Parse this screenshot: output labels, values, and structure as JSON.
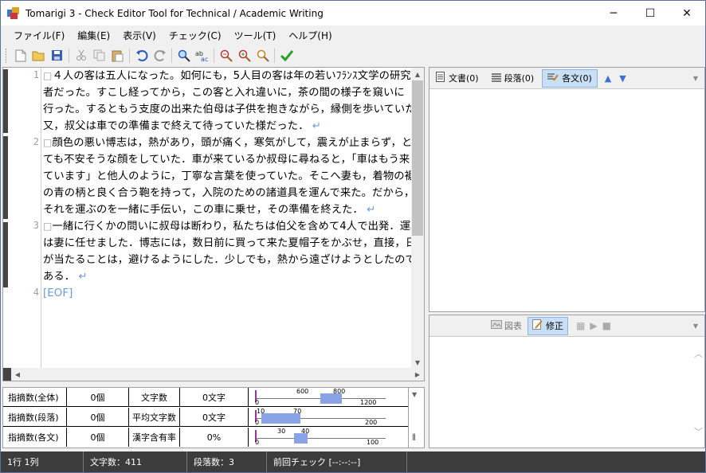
{
  "window": {
    "title": "Tomarigi 3 - Check Editor Tool for Technical / Academic Writing",
    "minimize": "─",
    "maximize": "☐",
    "close": "✕"
  },
  "menu": [
    "ファイル(F)",
    "編集(E)",
    "表示(V)",
    "チェック(C)",
    "ツール(T)",
    "ヘルプ(H)"
  ],
  "toolbar_icons": [
    "new-file-icon",
    "open-folder-icon",
    "save-icon",
    "cut-icon",
    "copy-icon",
    "paste-icon",
    "undo-icon",
    "redo-icon",
    "find-icon",
    "spell-check-icon",
    "zoom-prev-icon",
    "zoom-next-icon",
    "zoom-icon",
    "check-icon"
  ],
  "editor": {
    "line_numbers": [
      "1",
      "2",
      "3",
      "4"
    ],
    "lines": [
      "４人の客は五人になった。如何にも，5人目の客は年の若いﾌﾗﾝｽ文学の研究",
      "者だった。すこし経ってから，この客と入れ違いに，茶の間の様子を窺いに",
      "行った。するともう支度の出来た伯母は子供を抱きながら，縁側を歩いていた。",
      "又，叔父は車での準備まで終えて待っていた様だった．",
      "顔色の悪い博志は，熱があり，頭が痛く，寒気がして，震えが止まらず，と",
      "ても不安そうな顔をしていた．車が来ているか叔母に尋ねると，「車はもう来",
      "ています」と他人のように，丁寧な言葉を使っていた。そこへ妻も，着物の裾",
      "の青の柄と良く合う鞄を持って，入院のための諸道具を運んで来た。だから，",
      "それを運ぶのを一緒に手伝い，この車に乗せ，その準備を終えた．",
      "一緒に行くかの問いに叔母は断わり，私たちは伯父を含めて4人で出発．運転",
      "は妻に任せました．博志には，数日前に買って来た夏帽子をかぶせ，直接，日",
      "が当たることは，避けるようにした．少しでも，熱から遠ざけようとしたので",
      "ある．",
      "[EOF]"
    ],
    "para_marker": "□",
    "return_marker": "↵"
  },
  "stats": {
    "rows": [
      {
        "label": "指摘数(全体)",
        "count": "0個",
        "metric": "文字数",
        "value": "0文字",
        "scale_min": "0",
        "band_low": "600",
        "band_high": "800",
        "scale_max": "1200",
        "band_start": 0.5,
        "band_end": 0.667
      },
      {
        "label": "指摘数(段落)",
        "count": "0個",
        "metric": "平均文字数",
        "value": "0文字",
        "scale_min": "0",
        "band_low": "10",
        "band_high": "70",
        "scale_max": "200",
        "band_start": 0.05,
        "band_end": 0.35
      },
      {
        "label": "指摘数(各文)",
        "count": "0個",
        "metric": "漢字含有率",
        "value": "0%",
        "scale_min": "0",
        "band_low": "30",
        "band_high": "40",
        "scale_max": "100",
        "band_start": 0.3,
        "band_end": 0.4
      }
    ]
  },
  "right_top": {
    "tabs": [
      {
        "label": "文書(0)",
        "icon": "document-icon"
      },
      {
        "label": "段落(0)",
        "icon": "paragraph-icon"
      },
      {
        "label": "各文(0)",
        "icon": "sentence-icon"
      }
    ],
    "active_tab": "各文(0)"
  },
  "right_bottom": {
    "tabs": [
      {
        "label": "図表",
        "icon": "figure-icon"
      },
      {
        "label": "修正",
        "icon": "edit-icon"
      }
    ],
    "active_tab": "修正"
  },
  "statusbar": {
    "position": "1行 1列",
    "char_count": "文字数：411",
    "para_count": "段落数：3",
    "last_check": "前回チェック [--:--:--]"
  },
  "colors": {
    "gutter": "#444444",
    "return_marker": "#6a9be0",
    "gauge_band": "#8aa2e6",
    "active_tab": "#c9dff6",
    "statusbar": "#3c3c3c"
  }
}
